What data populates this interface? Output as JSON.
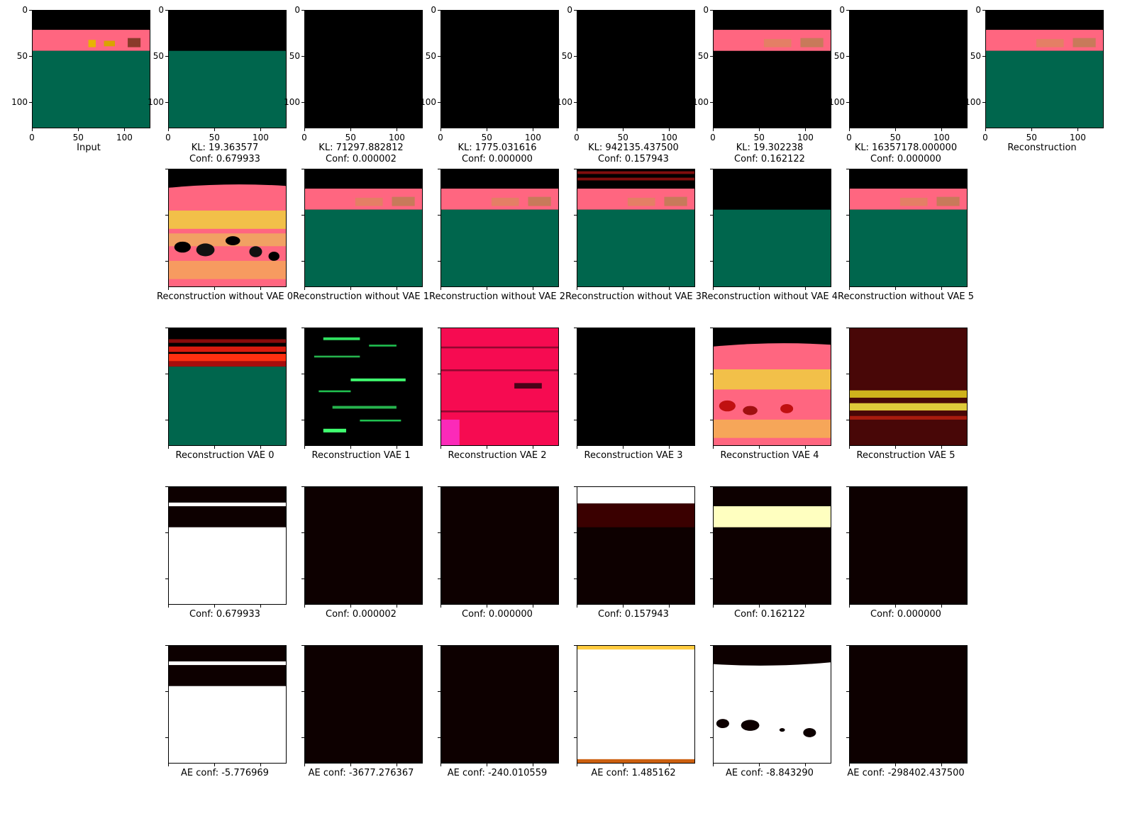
{
  "row1": {
    "tick_labels": {
      "y": [
        "0",
        "50",
        "100"
      ],
      "x": [
        "0",
        "50",
        "100"
      ]
    },
    "panels": [
      {
        "name": "input",
        "caption": "Input"
      },
      {
        "name": "vae0-output",
        "caption": "KL: 19.363577\nConf: 0.679933"
      },
      {
        "name": "vae1-output",
        "caption": "KL: 71297.882812\nConf: 0.000002"
      },
      {
        "name": "vae2-output",
        "caption": "KL: 1775.031616\nConf: 0.000000"
      },
      {
        "name": "vae3-output",
        "caption": "KL: 942135.437500\nConf: 0.157943"
      },
      {
        "name": "vae4-output",
        "caption": "KL: 19.302238\nConf: 0.162122"
      },
      {
        "name": "vae5-output",
        "caption": "KL: 16357178.000000\nConf: 0.000000"
      },
      {
        "name": "reconstruction",
        "caption": "Reconstruction"
      }
    ]
  },
  "row2": {
    "captions": [
      "Reconstruction without VAE 0",
      "Reconstruction without VAE 1",
      "Reconstruction without VAE 2",
      "Reconstruction without VAE 3",
      "Reconstruction without VAE 4",
      "Reconstruction without VAE 5"
    ]
  },
  "row3": {
    "captions": [
      "Reconstruction VAE 0",
      "Reconstruction VAE 1",
      "Reconstruction VAE 2",
      "Reconstruction VAE 3",
      "Reconstruction VAE 4",
      "Reconstruction VAE 5"
    ]
  },
  "row4": {
    "captions": [
      "Conf: 0.679933",
      "Conf: 0.000002",
      "Conf: 0.000000",
      "Conf: 0.157943",
      "Conf: 0.162122",
      "Conf: 0.000000"
    ]
  },
  "row5": {
    "captions": [
      "AE conf: -5.776969",
      "AE conf: -3677.276367",
      "AE conf: -240.010559",
      "AE conf: 1.485162",
      "AE conf: -8.843290",
      "AE conf: -298402.437500"
    ]
  },
  "colors": {
    "sky": "#ff6680",
    "ground": "#00664d",
    "black": "#000000",
    "dark_heat": "#0d0000",
    "white": "#ffffff",
    "pale_yellow": "#ffffc0"
  }
}
